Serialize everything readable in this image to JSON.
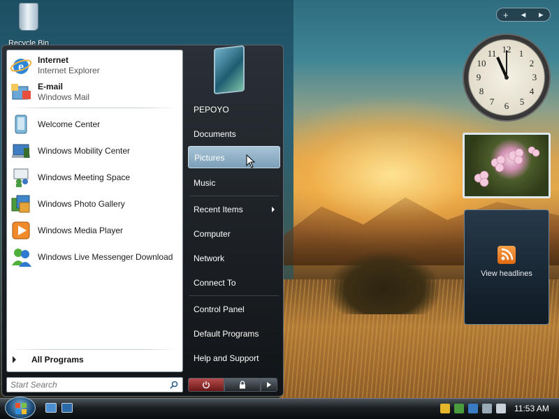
{
  "desktop": {
    "recycle_bin_label": "Recycle Bin"
  },
  "start_menu": {
    "pinned": [
      {
        "title": "Internet",
        "subtitle": "Internet Explorer",
        "icon": "internet-explorer-icon"
      },
      {
        "title": "E-mail",
        "subtitle": "Windows Mail",
        "icon": "windows-mail-icon"
      }
    ],
    "recent": [
      {
        "label": "Welcome Center",
        "icon": "welcome-center-icon"
      },
      {
        "label": "Windows Mobility Center",
        "icon": "mobility-center-icon"
      },
      {
        "label": "Windows Meeting Space",
        "icon": "meeting-space-icon"
      },
      {
        "label": "Windows Photo Gallery",
        "icon": "photo-gallery-icon"
      },
      {
        "label": "Windows Media Player",
        "icon": "media-player-icon"
      },
      {
        "label": "Windows Live Messenger Download",
        "icon": "messenger-icon"
      }
    ],
    "all_programs": "All Programs",
    "search_placeholder": "Start Search",
    "right_items": [
      {
        "label": "PEPOYO"
      },
      {
        "label": "Documents"
      },
      {
        "label": "Pictures",
        "selected": true
      },
      {
        "label": "Music"
      },
      {
        "label": "Recent Items",
        "submenu": true
      },
      {
        "label": "Computer"
      },
      {
        "label": "Network"
      },
      {
        "label": "Connect To"
      },
      {
        "label": "Control Panel"
      },
      {
        "label": "Default Programs"
      },
      {
        "label": "Help and Support"
      }
    ],
    "power_icon": "power-icon",
    "lock_icon": "lock-icon",
    "more_icon": "arrow-right-icon"
  },
  "sidebar": {
    "controls": [
      "+",
      "◂",
      "▸"
    ],
    "clock_time": "11:00",
    "feed_label": "View headlines"
  },
  "taskbar": {
    "time": "11:53 AM"
  },
  "colors": {
    "selection": "#8fb0c8",
    "power_button": "#9a2a2a",
    "rss_orange": "#f08a2a"
  }
}
